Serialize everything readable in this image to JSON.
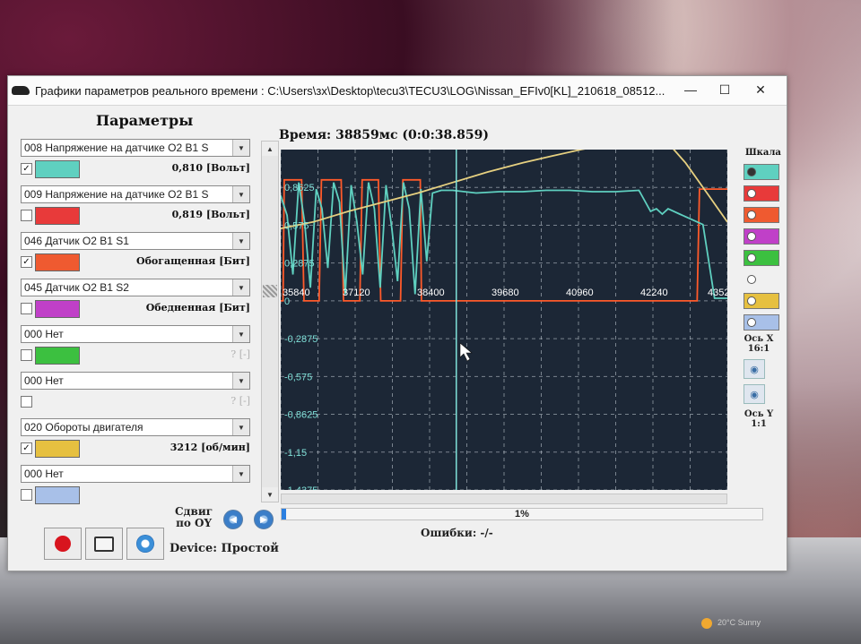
{
  "window": {
    "title": "Графики параметров реального времени : C:\\Users\\зх\\Desktop\\tecu3\\TECU3\\LOG\\Nissan_EFIv0[KL]_210618_08512..."
  },
  "controls": {
    "minimize": "—",
    "maximize": "☐",
    "close": "✕"
  },
  "params": {
    "title": "Параметры",
    "items": [
      {
        "select": "008 Напряжение на датчике O2 B1 S",
        "checked": true,
        "color": "#5fd0c0",
        "value": "0,810 [Вольт]",
        "dim": false
      },
      {
        "select": "009 Напряжение на датчике O2 B1 S",
        "checked": false,
        "color": "#e83a3a",
        "value": "0,819 [Вольт]",
        "dim": false
      },
      {
        "select": "046 Датчик O2 B1 S1",
        "checked": true,
        "color": "#ef5a30",
        "value": "Обогащенная [Бит]",
        "dim": false
      },
      {
        "select": "045 Датчик O2 B1 S2",
        "checked": false,
        "color": "#c040c8",
        "value": "Обедненная [Бит]",
        "dim": false
      },
      {
        "select": "000 Нет",
        "checked": false,
        "color": "#3cc040",
        "value": "? [-]",
        "dim": true
      },
      {
        "select": "000 Нет",
        "checked": false,
        "color": "",
        "value": "? [-]",
        "dim": true
      },
      {
        "select": "020 Обороты двигателя",
        "checked": true,
        "color": "#e6c040",
        "value": "3212 [об/мин]",
        "dim": false
      },
      {
        "select": "000 Нет",
        "checked": false,
        "color": "#a8c0e8",
        "value": "",
        "dim": true
      }
    ]
  },
  "chart_header": {
    "time": "Время: 38859мс (0:0:38.859)"
  },
  "chart_data": {
    "type": "line",
    "x_ticks": [
      "35840",
      "37120",
      "38400",
      "39680",
      "40960",
      "42240",
      "4352"
    ],
    "y_ticks": [
      "0,8625",
      "0,575",
      "0,2875",
      "0",
      "-0,2875",
      "-0,575",
      "-0,8625",
      "-1,15",
      "-1,4375"
    ],
    "xlim": [
      35840,
      43520
    ],
    "ylim": [
      -1.4375,
      1.15
    ],
    "cursor_x": 38859,
    "series": [
      {
        "color": "#ff5a2a",
        "kind": "square",
        "x": [
          35840,
          35880,
          35900,
          36200,
          36240,
          36500,
          36540,
          36880,
          36920,
          37200,
          37240,
          37520,
          37560,
          37900,
          37940,
          38240,
          38260,
          38360,
          38400,
          42000,
          43000,
          43040,
          43520
        ],
        "values": [
          0,
          0,
          0.92,
          0.92,
          0,
          0,
          0.92,
          0.92,
          0,
          0,
          0.92,
          0.92,
          0,
          0,
          0.92,
          0.92,
          0,
          0,
          0,
          0,
          0,
          0.85,
          0.85
        ]
      },
      {
        "color": "#5fd0c0",
        "kind": "line",
        "x": [
          35840,
          35950,
          36050,
          36150,
          36250,
          36350,
          36450,
          36550,
          36650,
          36750,
          36850,
          36950,
          37050,
          37150,
          37250,
          37350,
          37450,
          37550,
          37650,
          37750,
          37850,
          37950,
          38050,
          38150,
          38250,
          38350,
          38450,
          38600,
          38800,
          39200,
          39600,
          40000,
          40400,
          40800,
          41200,
          41600,
          42000,
          42200,
          42300,
          42400,
          42500,
          42700,
          42900,
          43100,
          43300,
          43520
        ],
        "values": [
          0.8,
          0.65,
          0.2,
          0.9,
          0.6,
          0.1,
          0.85,
          0.7,
          0.25,
          0.9,
          0.75,
          0.05,
          0.88,
          0.6,
          0.2,
          0.9,
          0.7,
          0.1,
          0.88,
          0.55,
          0.15,
          0.9,
          0.7,
          0.05,
          0.85,
          0.3,
          0.82,
          0.84,
          0.84,
          0.82,
          0.83,
          0.83,
          0.84,
          0.84,
          0.83,
          0.83,
          0.84,
          0.68,
          0.7,
          0.66,
          0.7,
          0.66,
          0.62,
          0.58,
          0.02,
          0.02
        ]
      },
      {
        "color": "#e6d080",
        "kind": "line",
        "x": [
          35840,
          36400,
          37000,
          37600,
          38200,
          38800,
          39400,
          40000,
          40500,
          41000,
          41600,
          42200,
          42400,
          42800,
          43200,
          43520
        ],
        "values": [
          0.55,
          0.6,
          0.68,
          0.75,
          0.82,
          0.9,
          0.98,
          1.05,
          1.1,
          1.15,
          1.2,
          1.25,
          1.25,
          1.05,
          0.8,
          0.6
        ]
      }
    ]
  },
  "status": {
    "progress_text": "1%",
    "progress": 0.01,
    "errors": "Ошибки: -/-"
  },
  "scale": {
    "title": "Шкала",
    "buttons": [
      {
        "color": "#5fd0c0",
        "selected": true
      },
      {
        "color": "#e83a3a",
        "selected": false
      },
      {
        "color": "#ef5a30",
        "selected": false
      },
      {
        "color": "#c040c8",
        "selected": false
      },
      {
        "color": "#3cc040",
        "selected": false
      },
      {
        "color": "",
        "selected": false
      },
      {
        "color": "#e6c040",
        "selected": false
      },
      {
        "color": "#a8c0e8",
        "selected": false
      }
    ],
    "axis_x": "Ось Х\n16:1",
    "axis_y": "Ось Y\n1:1"
  },
  "bottom": {
    "shift_label": "Сдвиг\nпо OY",
    "device": "Device: Простой"
  },
  "taskbar": {
    "text": "20°C Sunny"
  }
}
